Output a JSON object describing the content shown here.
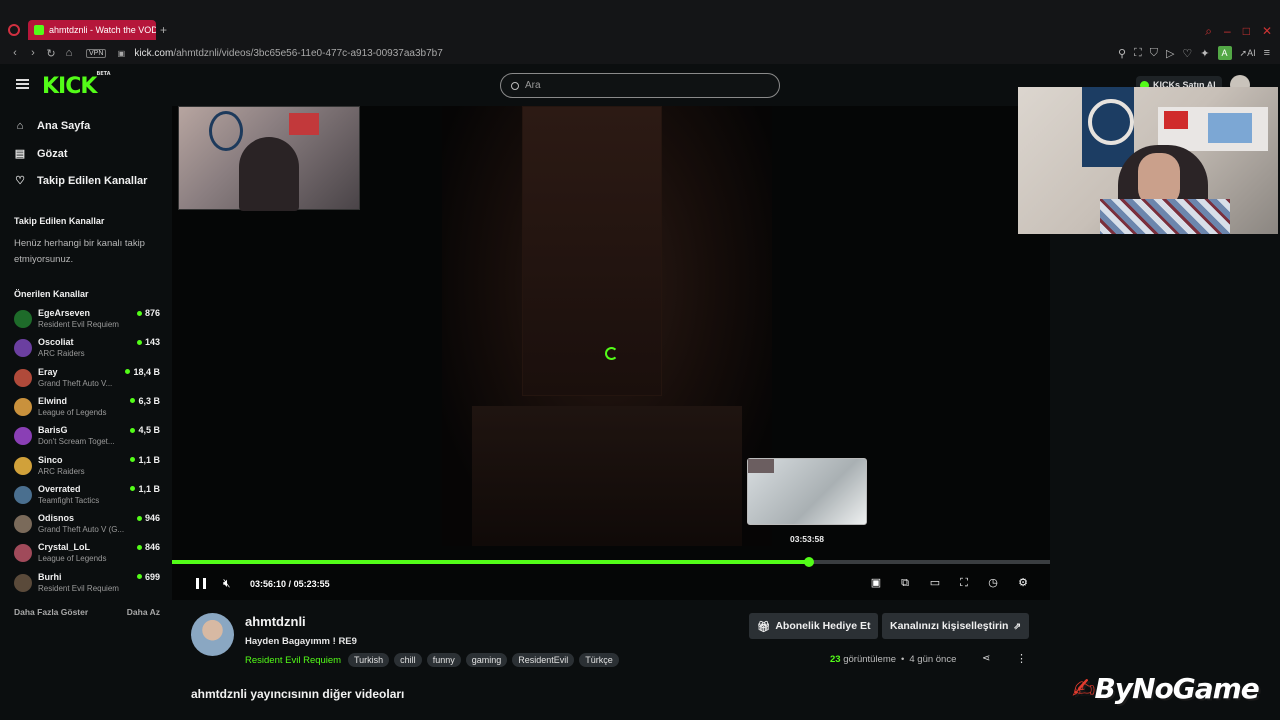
{
  "browser": {
    "tab_title": "ahmtdznli - Watch the VOD",
    "new_tab": "+",
    "vpn_label": "VPN",
    "url_domain": "kick.com",
    "url_path": "/ahmtdznli/videos/3bc65e56-11e0-477c-a913-00937aa3b7b7",
    "ai_label": "AI"
  },
  "header": {
    "logo": "KICK",
    "logo_badge": "BETA",
    "search_placeholder": "Ara",
    "buy_kicks_label": "KICKs Satın Al"
  },
  "sidebar": {
    "nav": [
      {
        "label": "Ana Sayfa",
        "icon": "home-icon"
      },
      {
        "label": "Gözat",
        "icon": "browse-icon"
      },
      {
        "label": "Takip Edilen Kanallar",
        "icon": "heart-icon"
      }
    ],
    "followed_title": "Takip Edilen Kanallar",
    "followed_empty": "Henüz herhangi bir kanalı takip etmiyorsunuz.",
    "recommended_title": "Önerilen Kanallar",
    "recommended": [
      {
        "name": "EgeArseven",
        "game": "Resident Evil Requiem",
        "viewers": "876",
        "color": "#1e6b2a"
      },
      {
        "name": "Oscoliat",
        "game": "ARC Raiders",
        "viewers": "143",
        "color": "#6b3fa0"
      },
      {
        "name": "Eray",
        "game": "Grand Theft Auto V...",
        "viewers": "18,4 B",
        "color": "#b04a3a"
      },
      {
        "name": "Elwind",
        "game": "League of Legends",
        "viewers": "6,3 B",
        "color": "#c9913c"
      },
      {
        "name": "BarisG",
        "game": "Don't Scream Toget...",
        "viewers": "4,5 B",
        "color": "#8a3fb5"
      },
      {
        "name": "Sinco",
        "game": "ARC Raiders",
        "viewers": "1,1 B",
        "color": "#d1a13a"
      },
      {
        "name": "Overrated",
        "game": "Teamfight Tactics",
        "viewers": "1,1 B",
        "color": "#4a6f8f"
      },
      {
        "name": "Odisnos",
        "game": "Grand Theft Auto V (G...",
        "viewers": "946",
        "color": "#7a6a5a"
      },
      {
        "name": "Crystal_LoL",
        "game": "League of Legends",
        "viewers": "846",
        "color": "#a04a5a"
      },
      {
        "name": "Burhi",
        "game": "Resident Evil Requiem",
        "viewers": "699",
        "color": "#5a4a3a"
      }
    ],
    "show_more": "Daha Fazla Göster",
    "show_less": "Daha Az"
  },
  "player": {
    "preview_time": "03:53:58",
    "current_time": "03:56:10",
    "time_separator": "/",
    "duration": "05:23:55",
    "progress_fraction": 0.726
  },
  "video": {
    "channel": "ahmtdznli",
    "title": "Hayden Bagayımm ! RE9",
    "category": "Resident Evil Requiem",
    "tags": [
      "Turkish",
      "chill",
      "funny",
      "gaming",
      "ResidentEvil",
      "Türkçe"
    ],
    "gift_label": "Abonelik Hediye Et",
    "customize_label": "Kanalınızı kişiselleştirin",
    "views_count": "23",
    "views_label": "görüntüleme",
    "dot": "•",
    "posted": "4 gün önce",
    "other_videos_heading": "ahmtdznli yayıncısının diğer videoları"
  },
  "watermark": {
    "text": "ByNoGame"
  },
  "colors": {
    "accent": "#53fc18",
    "tab": "#b5163a",
    "background": "#0b0e0f"
  }
}
